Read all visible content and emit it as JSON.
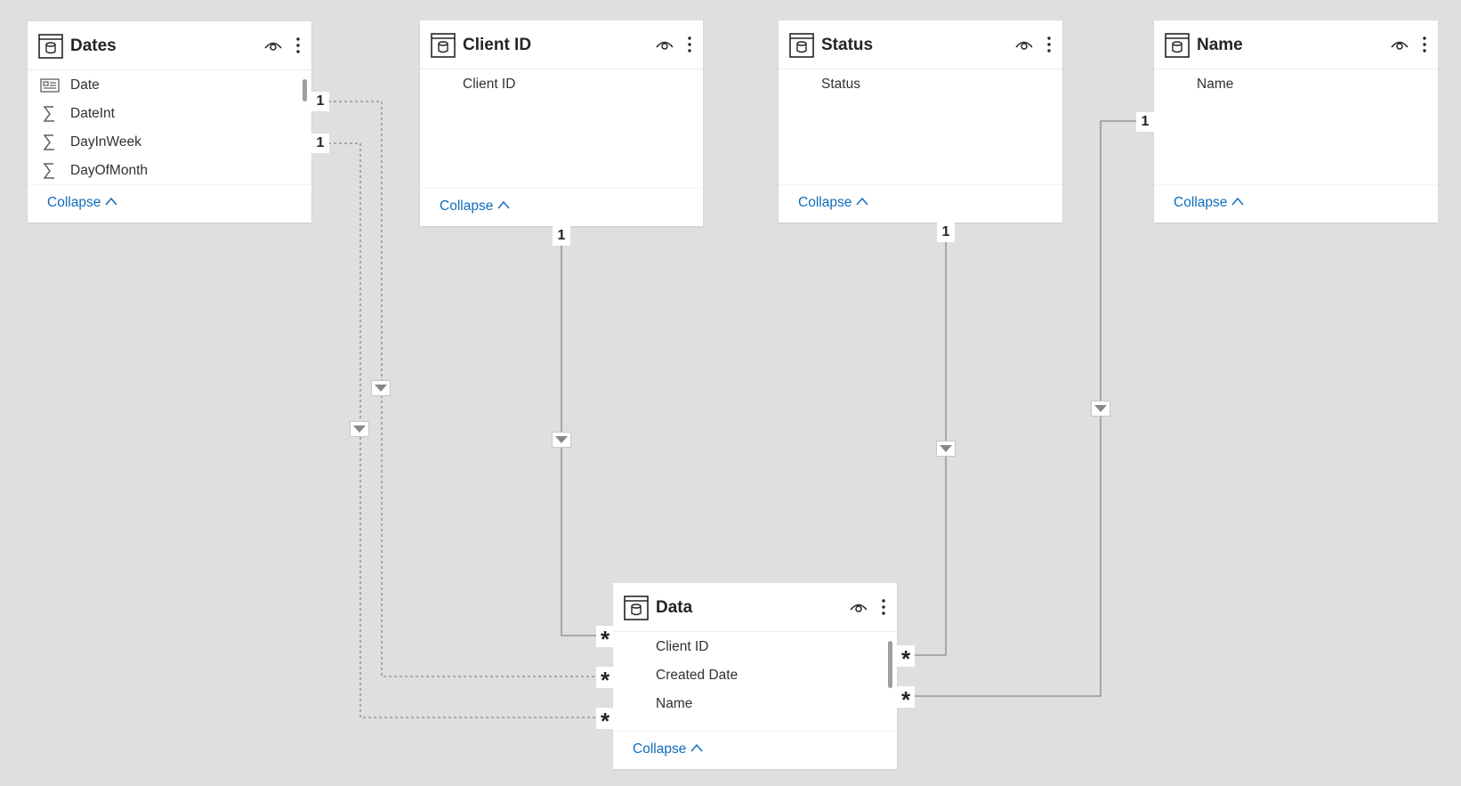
{
  "tables": {
    "dates": {
      "title": "Dates",
      "fields": [
        {
          "label": "Date",
          "icon": "calendar-field-icon"
        },
        {
          "label": "DateInt",
          "icon": "sigma-icon"
        },
        {
          "label": "DayInWeek",
          "icon": "sigma-icon"
        },
        {
          "label": "DayOfMonth",
          "icon": "sigma-icon"
        }
      ],
      "collapse_label": "Collapse"
    },
    "client_id": {
      "title": "Client ID",
      "fields": [
        {
          "label": "Client ID"
        }
      ],
      "collapse_label": "Collapse"
    },
    "status": {
      "title": "Status",
      "fields": [
        {
          "label": "Status"
        }
      ],
      "collapse_label": "Collapse"
    },
    "name": {
      "title": "Name",
      "fields": [
        {
          "label": "Name"
        }
      ],
      "collapse_label": "Collapse"
    },
    "data": {
      "title": "Data",
      "fields": [
        {
          "label": "Client ID"
        },
        {
          "label": "Created Date"
        },
        {
          "label": "Name"
        }
      ],
      "collapse_label": "Collapse"
    }
  },
  "relationships": [
    {
      "from": "Dates",
      "to": "Data",
      "from_cardinality": "1",
      "to_cardinality": "*",
      "style": "inactive-dashed"
    },
    {
      "from": "Dates",
      "to": "Data",
      "from_cardinality": "1",
      "to_cardinality": "*",
      "style": "inactive-dashed"
    },
    {
      "from": "Client ID",
      "to": "Data",
      "from_cardinality": "1",
      "to_cardinality": "*",
      "style": "active-solid"
    },
    {
      "from": "Status",
      "to": "Data",
      "from_cardinality": "1",
      "to_cardinality": "*",
      "style": "active-solid"
    },
    {
      "from": "Name",
      "to": "Data",
      "from_cardinality": "1",
      "to_cardinality": "*",
      "style": "active-solid"
    }
  ],
  "colors": {
    "canvas": "#e1dfdd",
    "card": "#ffffff",
    "link": "#0f6cbd",
    "line": "#8a8886"
  }
}
